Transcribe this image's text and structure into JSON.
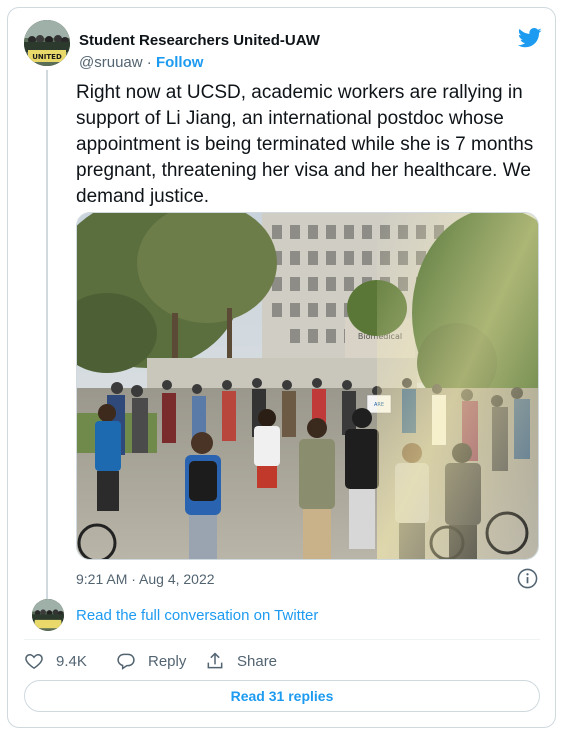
{
  "account": {
    "display_name": "Student Researchers United-UAW",
    "handle": "@sruuaw",
    "separator": " · ",
    "follow_label": "Follow",
    "avatar_text": "UNITED"
  },
  "tweet": {
    "text": "Right now at UCSD, academic workers are rallying in support of Li Jiang, an international postdoc whose appointment is being terminated while she is 7 months pregnant, threatening her visa and her healthcare. We demand justice.",
    "photo_sign_text": "Biomedical",
    "photo_poster_text": "ARE\nKING",
    "timestamp": "9:21 AM · Aug 4, 2022"
  },
  "conversation_link": "Read the full conversation on Twitter",
  "actions": {
    "like_count": "9.4K",
    "reply_label": "Reply",
    "share_label": "Share"
  },
  "read_replies_label": "Read 31 replies",
  "icons": {
    "brand": "twitter-bird-icon",
    "info": "info-icon",
    "like": "heart-icon",
    "reply": "speech-bubble-icon",
    "share": "share-upload-icon"
  },
  "colors": {
    "accent": "#1d9bf0",
    "text": "#0f1419",
    "muted": "#536471",
    "border": "#cfd9de"
  }
}
